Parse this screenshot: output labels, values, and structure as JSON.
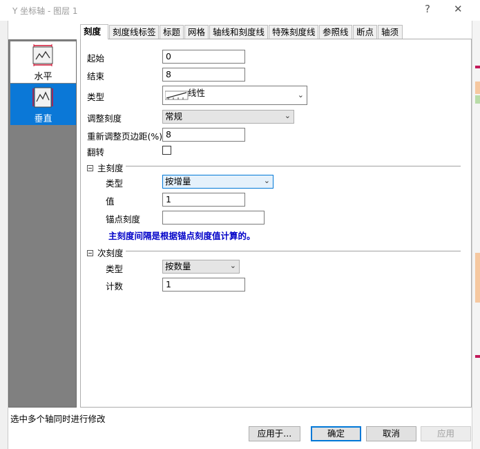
{
  "window": {
    "title": "Y 坐标轴 - 图层 1",
    "help_glyph": "?",
    "close_glyph": "✕"
  },
  "left_list": {
    "items": [
      {
        "label": "水平",
        "icon": "horizontal-axis-icon",
        "selected": false
      },
      {
        "label": "垂直",
        "icon": "vertical-axis-icon",
        "selected": true
      }
    ]
  },
  "tabs": [
    "刻度",
    "刻度线标签",
    "标题",
    "网格",
    "轴线和刻度线",
    "特殊刻度线",
    "参照线",
    "断点",
    "轴须"
  ],
  "active_tab": "刻度",
  "scale": {
    "start_label": "起始",
    "start_value": "0",
    "end_label": "结束",
    "end_value": "8",
    "type_label": "类型",
    "type_value": "线性",
    "rescale_label": "调整刻度",
    "rescale_value": "常规",
    "margin_label": "重新调整页边距(%)",
    "margin_value": "8",
    "flip_label": "翻转",
    "flip_checked": false
  },
  "major": {
    "section_label": "主刻度",
    "type_label": "类型",
    "type_value": "按增量",
    "value_label": "值",
    "value_value": "1",
    "anchor_label": "锚点刻度",
    "anchor_value": "",
    "note": "主刻度间隔是根据锚点刻度值计算的。"
  },
  "minor": {
    "section_label": "次刻度",
    "type_label": "类型",
    "type_value": "按数量",
    "count_label": "计数",
    "count_value": "1"
  },
  "status_text": "选中多个轴同时进行修改",
  "buttons": {
    "apply_to": "应用于...",
    "ok": "确定",
    "cancel": "取消",
    "apply": "应用"
  },
  "colors": {
    "selection": "#0b78d7",
    "note_text": "#0000c8",
    "focus_border": "#0078d7"
  }
}
